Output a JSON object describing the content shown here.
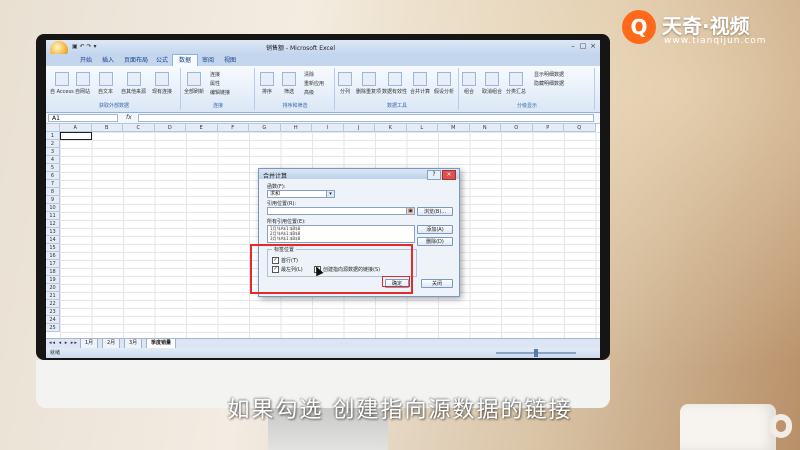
{
  "brand": {
    "logo_char": "Q",
    "name": "天奇·视频",
    "url": "www.tianqijun.com"
  },
  "excel": {
    "window_title": "销售额 - Microsoft Excel",
    "qat_text": "▣ ↶ ↷ ▾",
    "tabs": [
      "开始",
      "插入",
      "页面布局",
      "公式",
      "数据",
      "审阅",
      "视图"
    ],
    "active_tab": "数据",
    "ribbon_groups": [
      {
        "label": "获取外部数据",
        "buttons": [
          "自 Access",
          "自网站",
          "自文本",
          "自其他来源",
          "现有连接"
        ]
      },
      {
        "label": "连接",
        "buttons": [
          "全部刷新",
          "连接",
          "属性",
          "编辑链接"
        ]
      },
      {
        "label": "排序和筛选",
        "buttons": [
          "排序",
          "筛选",
          "清除",
          "重新应用",
          "高级"
        ]
      },
      {
        "label": "数据工具",
        "buttons": [
          "分列",
          "删除重复项",
          "数据有效性",
          "合并计算",
          "假设分析"
        ]
      },
      {
        "label": "分级显示",
        "buttons": [
          "组合",
          "取消组合",
          "分类汇总",
          "显示明细数据",
          "隐藏明细数据"
        ]
      }
    ],
    "name_box": "A1",
    "fx": "fx",
    "columns": [
      "A",
      "B",
      "C",
      "D",
      "E",
      "F",
      "G",
      "H",
      "I",
      "J",
      "K",
      "L",
      "M",
      "N",
      "O",
      "P",
      "Q"
    ],
    "rows": [
      "1",
      "2",
      "3",
      "4",
      "5",
      "6",
      "7",
      "8",
      "9",
      "10",
      "11",
      "12",
      "13",
      "14",
      "15",
      "16",
      "17",
      "18",
      "19",
      "20",
      "21",
      "22",
      "23",
      "24",
      "25"
    ],
    "sheet_nav": "◂◂ ◂ ▸ ▸▸",
    "sheets": [
      "1月",
      "2月",
      "3月",
      "季度销量"
    ],
    "active_sheet": "季度销量",
    "status": "就绪"
  },
  "dialog": {
    "title": "合并计算",
    "function_label": "函数(F):",
    "function_value": "求和",
    "reference_label": "引用位置(R):",
    "browse_button": "浏览(B)...",
    "all_refs_label": "所有引用位置(E):",
    "refs": [
      "1月!$A$1:$B$8",
      "2月!$A$1:$B$8",
      "3月!$A$1:$B$8"
    ],
    "add_button": "添加(A)",
    "delete_button": "删除(D)",
    "label_pos_title": "标签位置",
    "chk_top_row": "首行(T)",
    "chk_left_col": "最左列(L)",
    "chk_link": "创建指向源数据的链接(S)",
    "ok_button": "确定",
    "close_button": "关闭",
    "help_button": "?",
    "x_button": "×"
  },
  "subtitle": "如果勾选 创建指向源数据的链接"
}
